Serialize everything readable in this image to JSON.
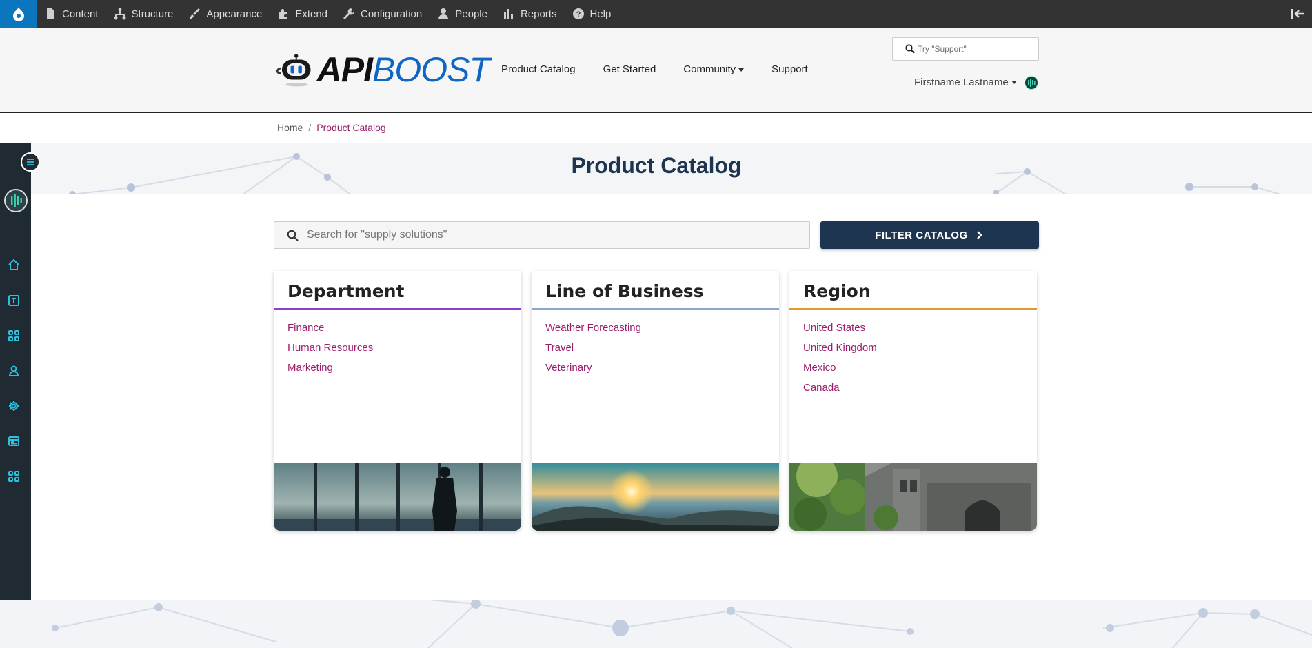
{
  "admin_toolbar": {
    "items": [
      {
        "label": "Content",
        "icon": "file-icon"
      },
      {
        "label": "Structure",
        "icon": "structure-icon"
      },
      {
        "label": "Appearance",
        "icon": "paintbrush-icon"
      },
      {
        "label": "Extend",
        "icon": "puzzle-icon"
      },
      {
        "label": "Configuration",
        "icon": "wrench-icon"
      },
      {
        "label": "People",
        "icon": "person-icon"
      },
      {
        "label": "Reports",
        "icon": "bar-chart-icon"
      },
      {
        "label": "Help",
        "icon": "help-icon"
      }
    ]
  },
  "header": {
    "logo_api": "API",
    "logo_boost": "BOOST",
    "nav": {
      "product_catalog": "Product Catalog",
      "get_started": "Get Started",
      "community": "Community",
      "support": "Support"
    },
    "search_placeholder": "Try \"Support\"",
    "user_name": "Firstname Lastname"
  },
  "breadcrumb": {
    "home": "Home",
    "separator": "/",
    "current": "Product Catalog"
  },
  "page_title": "Product Catalog",
  "catalog_search_placeholder": "Search for \"supply solutions\"",
  "filter_button": "FILTER CATALOG",
  "cards": [
    {
      "title": "Department",
      "accent": "#8e3fd0",
      "links": [
        "Finance",
        "Human Resources",
        "Marketing"
      ]
    },
    {
      "title": "Line of Business",
      "accent": "#8aa6c9",
      "links": [
        "Weather Forecasting",
        "Travel",
        "Veterinary"
      ]
    },
    {
      "title": "Region",
      "accent": "#e39a2c",
      "links": [
        "United States",
        "United Kingdom",
        "Mexico",
        "Canada"
      ]
    }
  ],
  "colors": {
    "brand_navy": "#1d3550",
    "link_magenta": "#9c1e6b",
    "sidebar_icon_cyan": "#2bc1e0"
  }
}
